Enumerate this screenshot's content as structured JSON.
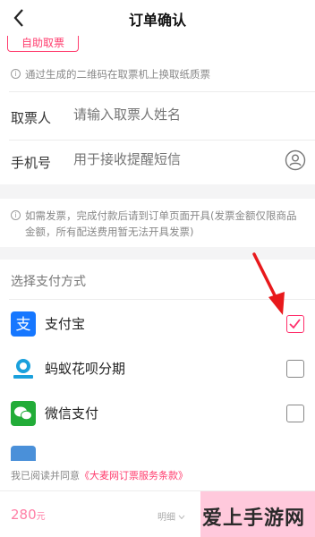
{
  "header": {
    "title": "订单确认"
  },
  "ticket": {
    "tag_label": "自助取票",
    "tip": "通过生成的二维码在取票机上换取纸质票",
    "name_label": "取票人",
    "name_placeholder": "请输入取票人姓名",
    "phone_label": "手机号",
    "phone_placeholder": "用于接收提醒短信"
  },
  "invoice": {
    "tip": "如需发票，完成付款后请到订单页面开具(发票金额仅限商品金额，所有配送费用暂无法开具发票)"
  },
  "payment": {
    "heading": "选择支付方式",
    "methods": [
      {
        "name": "支付宝",
        "icon": "alipay-icon",
        "checked": true,
        "color": "#1677ff"
      },
      {
        "name": "蚂蚁花呗分期",
        "icon": "huabei-icon",
        "checked": false,
        "color": "#1aa0dc"
      },
      {
        "name": "微信支付",
        "icon": "wechat-icon",
        "checked": false,
        "color": "#22ac38"
      }
    ]
  },
  "agreement": {
    "prefix": "我已阅读并同意",
    "link": "《大麦网订票服务条款》"
  },
  "footer": {
    "price": "280",
    "price_unit": "元",
    "detail": "明细"
  },
  "watermark": "爱上手游网",
  "colors": {
    "accent": "#ff3d6e",
    "annotation_arrow": "#e8191c"
  }
}
